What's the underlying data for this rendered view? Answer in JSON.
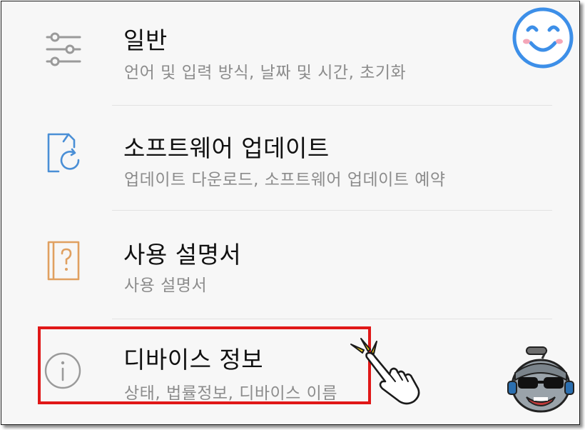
{
  "settings": {
    "items": [
      {
        "title": "일반",
        "subtitle": "언어 및 입력 방식, 날짜 및 시간, 초기화",
        "icon": "sliders-icon"
      },
      {
        "title": "소프트웨어 업데이트",
        "subtitle": "업데이트 다운로드, 소프트웨어 업데이트 예약",
        "icon": "software-update-icon"
      },
      {
        "title": "사용 설명서",
        "subtitle": "사용 설명서",
        "icon": "user-manual-icon"
      },
      {
        "title": "디바이스 정보",
        "subtitle": "상태, 법률정보, 디바이스 이름",
        "icon": "info-icon"
      }
    ]
  },
  "colors": {
    "highlight": "#e01818",
    "update_icon": "#4a8fd6",
    "manual_icon": "#e0a060",
    "gray_icon": "#9a9a9a",
    "smiley": "#3d8fe8"
  }
}
